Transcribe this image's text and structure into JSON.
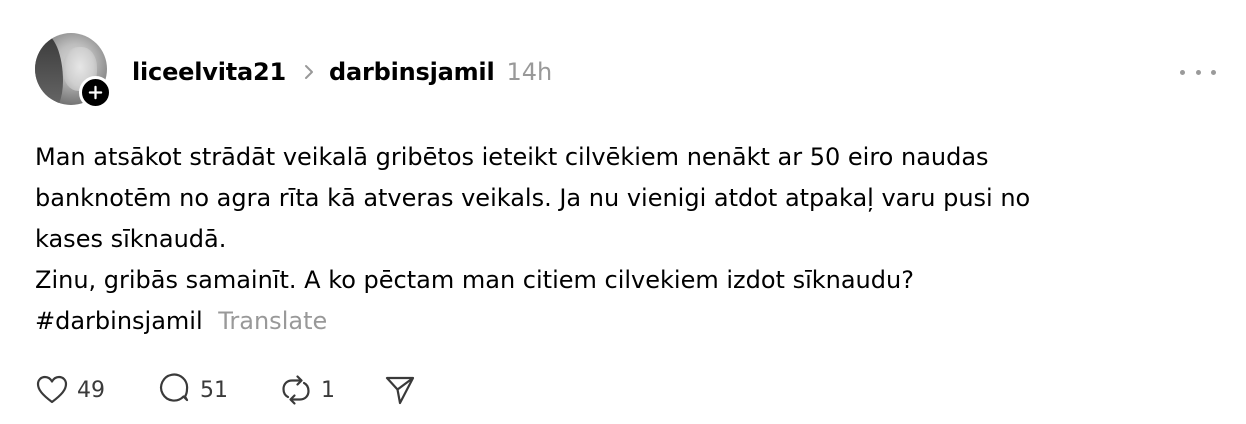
{
  "post": {
    "username": "liceelvita21",
    "community": "darbinsjamil",
    "time": "14h",
    "body_lines": [
      "Man atsākot strādāt veikalā gribētos ieteikt cilvēkiem nenākt ar 50 eiro naudas",
      "banknotēm no agra rīta kā atveras veikals. Ja nu vienigi atdot atpakaļ varu pusi no",
      "kases sīknaudā.",
      "Zinu, gribās samainīt. A ko pēctam man citiem cilvekiem izdot sīknaudu?"
    ],
    "hashtag": "#darbinsjamil",
    "translate_label": "Translate",
    "likes": "49",
    "replies": "51",
    "reposts": "1"
  },
  "icons": {
    "follow": "plus-icon",
    "separator": "chevron-right-icon",
    "more": "more-horizontal-icon",
    "like": "heart-icon",
    "reply": "comment-icon",
    "repost": "repost-icon",
    "share": "send-icon"
  },
  "colors": {
    "text": "#000000",
    "muted": "#999999",
    "icon": "#3a3a3a"
  }
}
